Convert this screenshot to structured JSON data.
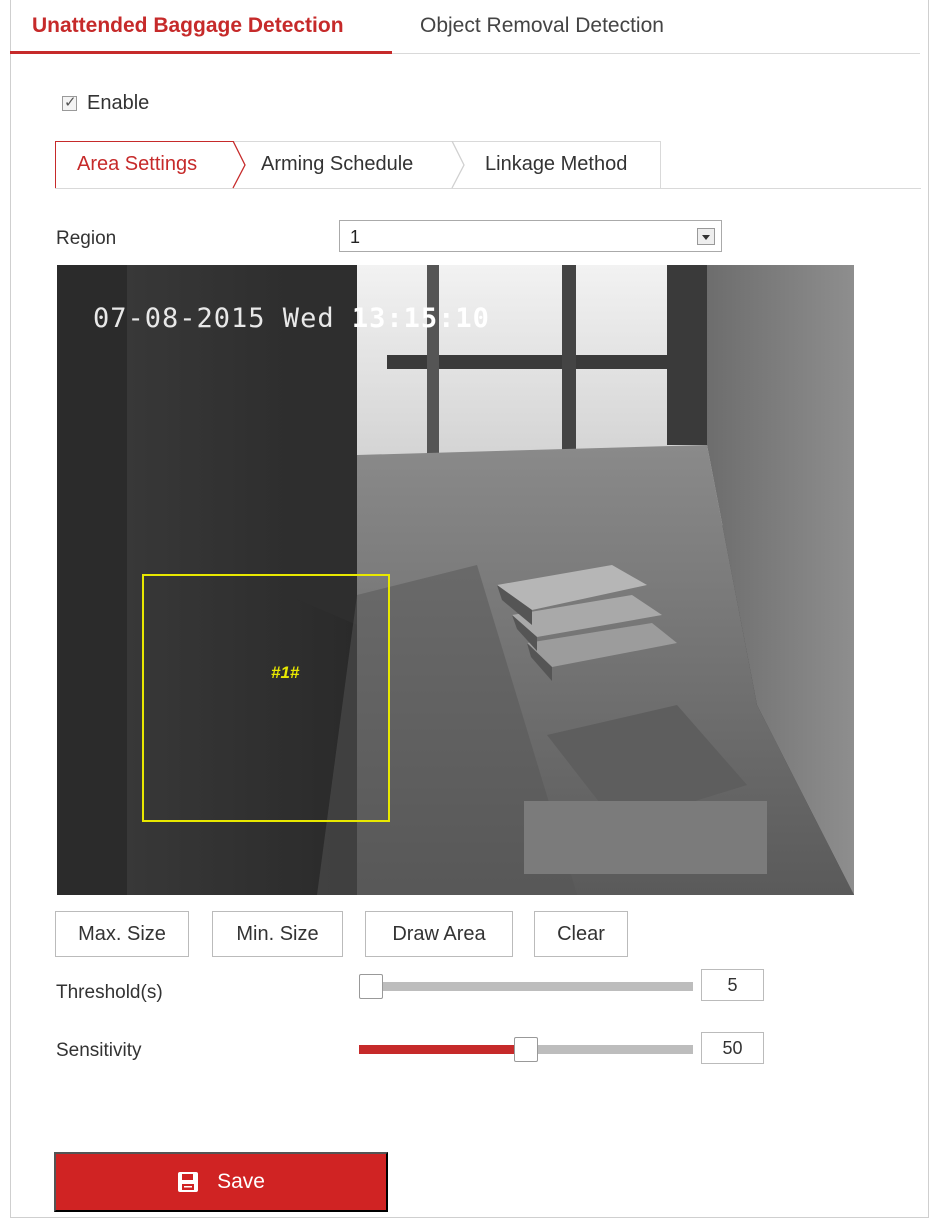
{
  "top_tabs": {
    "active": "Unattended Baggage Detection",
    "inactive": "Object Removal Detection"
  },
  "enable": {
    "label": "Enable",
    "checked": true
  },
  "sub_tabs": [
    "Area Settings",
    "Arming Schedule",
    "Linkage Method"
  ],
  "region": {
    "label": "Region",
    "value": "1"
  },
  "video": {
    "osd_date": "07-08-2015 Wed",
    "osd_time": "13:15:10",
    "zone_label": "#1#"
  },
  "buttons": {
    "max_size": "Max. Size",
    "min_size": "Min. Size",
    "draw_area": "Draw Area",
    "clear": "Clear"
  },
  "threshold": {
    "label": "Threshold(s)",
    "value": "5",
    "fraction": 0.0
  },
  "sensitivity": {
    "label": "Sensitivity",
    "value": "50",
    "fraction": 0.5
  },
  "save": {
    "label": "Save"
  },
  "colors": {
    "accent": "#c62a2a",
    "zone": "#e8e800",
    "save_bg": "#d02323"
  }
}
